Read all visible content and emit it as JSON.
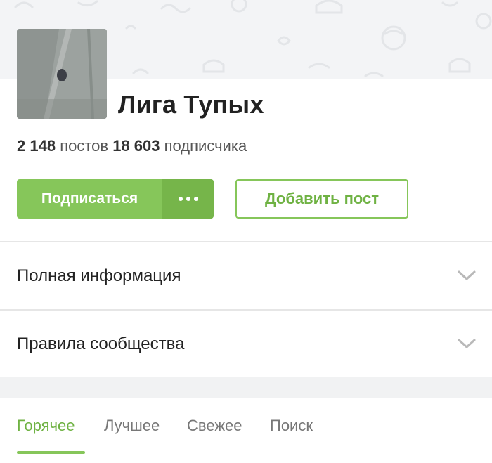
{
  "community": {
    "title": "Лига Тупых",
    "posts_count": "2 148",
    "posts_label": "постов",
    "subscribers_count": "18 603",
    "subscribers_label": "подписчика"
  },
  "actions": {
    "subscribe_label": "Подписаться",
    "more_label": "•••",
    "add_post_label": "Добавить пост"
  },
  "sections": [
    {
      "label": "Полная информация",
      "icon": "chevron-down-icon"
    },
    {
      "label": "Правила сообщества",
      "icon": "chevron-down-icon"
    }
  ],
  "tabs": [
    {
      "label": "Горячее",
      "active": true
    },
    {
      "label": "Лучшее",
      "active": false
    },
    {
      "label": "Свежее",
      "active": false
    },
    {
      "label": "Поиск",
      "active": false
    }
  ],
  "colors": {
    "accent": "#86c65a",
    "accent_dark": "#76b54a",
    "accent_text": "#6fb243"
  }
}
